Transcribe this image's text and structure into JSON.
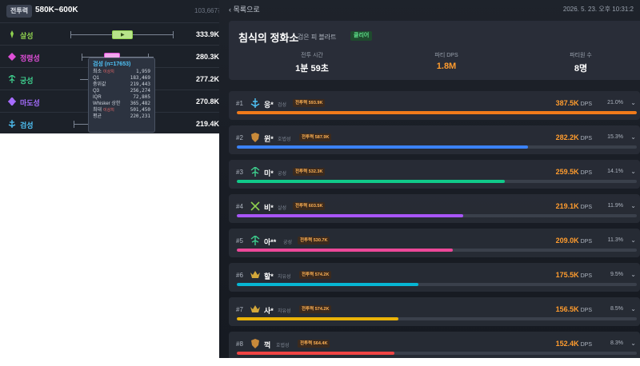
{
  "boxplot_panel": {
    "cp_label": "전투력",
    "cp_range": "580K~600K",
    "sample_count": "103,667건",
    "rows": [
      {
        "name": "살성",
        "value": "333.9K",
        "color": "#8fd14f",
        "icon": "dagger-icon"
      },
      {
        "name": "정령성",
        "value": "280.3K",
        "color": "#e04fd8",
        "icon": "diamond-icon"
      },
      {
        "name": "궁성",
        "value": "277.2K",
        "color": "#3ecf8e",
        "icon": "bow-icon"
      },
      {
        "name": "마도성",
        "value": "270.8K",
        "color": "#a66cff",
        "icon": "orb-icon"
      },
      {
        "name": "검성",
        "value": "219.4K",
        "color": "#4fc3f7",
        "icon": "sword-icon"
      }
    ],
    "tooltip": {
      "title": "검성 (n=17653)",
      "rows": [
        {
          "label": "최소",
          "tag": "이상치",
          "value": "1,959"
        },
        {
          "label": "Q1",
          "tag": "",
          "value": "183,469"
        },
        {
          "label": "중위값",
          "tag": "",
          "value": "219,443"
        },
        {
          "label": "Q3",
          "tag": "",
          "value": "256,274"
        },
        {
          "label": "IQR",
          "tag": "",
          "value": "72,805"
        },
        {
          "label": "Whisker 상한",
          "tag": "",
          "value": "365,482"
        },
        {
          "label": "최대",
          "tag": "이상치",
          "value": "501,450"
        },
        {
          "label": "평균",
          "tag": "",
          "value": "220,231"
        }
      ]
    }
  },
  "party_panel": {
    "back_label": "목록으로",
    "timestamp": "2026. 5. 23. 오후 10:31:2",
    "dungeon": "침식의 정화소",
    "difficulty": "· 검은 피 블라트",
    "clear_badge": "클리어",
    "stats": [
      {
        "label": "전투 시간",
        "value": "1분 59초"
      },
      {
        "label": "파티 DPS",
        "value": "1.8M"
      },
      {
        "label": "파티원 수",
        "value": "8명"
      }
    ],
    "dps_unit": "DPS",
    "members": [
      {
        "rank": "#1",
        "name": "응*",
        "class": "검성",
        "cp": "전투력 593.9K",
        "dps": "387.5K",
        "pct": "21.0%",
        "share": 1.0,
        "color": "#f07a1a",
        "icon": "sword-icon"
      },
      {
        "rank": "#2",
        "name": "윈*",
        "class": "호법성",
        "cp": "전투력 587.9K",
        "dps": "282.2K",
        "pct": "15.3%",
        "share": 0.728,
        "color": "#3b82f6",
        "icon": "shield-icon"
      },
      {
        "rank": "#3",
        "name": "미*",
        "class": "궁성",
        "cp": "전투력 532.3K",
        "dps": "259.5K",
        "pct": "14.1%",
        "share": 0.67,
        "color": "#10c98a",
        "icon": "bow-icon"
      },
      {
        "rank": "#4",
        "name": "비*",
        "class": "살성",
        "cp": "전투력 603.5K",
        "dps": "219.1K",
        "pct": "11.9%",
        "share": 0.565,
        "color": "#a855f7",
        "icon": "dagger-icon"
      },
      {
        "rank": "#5",
        "name": "아**",
        "class": "궁성",
        "cp": "전투력 530.7K",
        "dps": "209.0K",
        "pct": "11.3%",
        "share": 0.539,
        "color": "#ec4899",
        "icon": "bow-icon"
      },
      {
        "rank": "#6",
        "name": "할*",
        "class": "치유성",
        "cp": "전투력 574.2K",
        "dps": "175.5K",
        "pct": "9.5%",
        "share": 0.453,
        "color": "#06b6d4",
        "icon": "crown-icon"
      },
      {
        "rank": "#7",
        "name": "사*",
        "class": "치유성",
        "cp": "전투력 574.2K",
        "dps": "156.5K",
        "pct": "8.5%",
        "share": 0.404,
        "color": "#eab308",
        "icon": "crown-icon"
      },
      {
        "rank": "#8",
        "name": "꺽",
        "class": "호법성",
        "cp": "전투력 564.4K",
        "dps": "152.4K",
        "pct": "8.3%",
        "share": 0.393,
        "color": "#ef4444",
        "icon": "shield-icon"
      }
    ]
  }
}
